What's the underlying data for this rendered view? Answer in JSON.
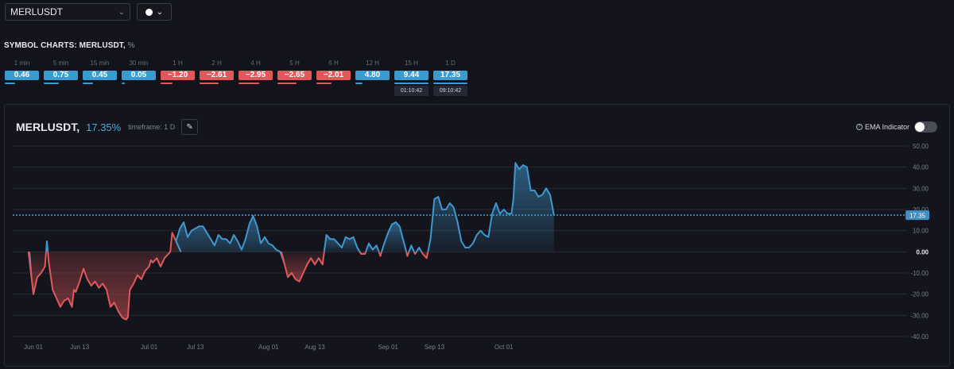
{
  "top": {
    "symbol": "MERLUSDT",
    "symbol_chevron": "chevron-down-icon",
    "color_chevron": "chevron-down-icon",
    "color_value": "#ffffff"
  },
  "section": {
    "title": "SYMBOL CHARTS: MERLUSDT,",
    "unit": "%"
  },
  "timeframes": [
    {
      "label": "1 min",
      "value": "0.46",
      "color": "#3a9bd1",
      "bar": 0.3
    },
    {
      "label": "5 min",
      "value": "0.75",
      "color": "#3a9bd1",
      "bar": 0.45
    },
    {
      "label": "15 min",
      "value": "0.45",
      "color": "#3a9bd1",
      "bar": 0.3
    },
    {
      "label": "30 min",
      "value": "0.05",
      "color": "#3a9bd1",
      "bar": 0.1
    },
    {
      "label": "1 H",
      "value": "−1.20",
      "color": "#e0585a",
      "bar": 0.35
    },
    {
      "label": "2 H",
      "value": "−2.61",
      "color": "#e0585a",
      "bar": 0.55
    },
    {
      "label": "4 H",
      "value": "−2.95",
      "color": "#e0585a",
      "bar": 0.6
    },
    {
      "label": "5 H",
      "value": "−2.65",
      "color": "#e0585a",
      "bar": 0.55
    },
    {
      "label": "6 H",
      "value": "−2.01",
      "color": "#e0585a",
      "bar": 0.45
    },
    {
      "label": "12 H",
      "value": "4.80",
      "color": "#3a9bd1",
      "bar": 0.2
    },
    {
      "label": "15 H",
      "value": "9.44",
      "color": "#3a9bd1",
      "bar": 1.0,
      "timer": "01:10:42"
    },
    {
      "label": "1 D",
      "value": "17.35",
      "color": "#3a9bd1",
      "bar": 1.0,
      "timer": "09:10:42"
    }
  ],
  "chart_header": {
    "symbol": "MERLUSDT,",
    "change": "17.35%",
    "timeframe": "timeframe: 1 D",
    "tool_icon": "pen-icon",
    "ema_label": "EMA Indicator",
    "ema_icon": "info-icon",
    "ema_enabled": false
  },
  "colors": {
    "positive": "#3f97cf",
    "negative": "#e0585a",
    "current_line": "#3f97cf",
    "badge_bg": "#3f8fc4"
  },
  "chart_data": {
    "type": "area",
    "title": "MERLUSDT, 17.35%",
    "xlabel": "",
    "ylabel": "",
    "ylim": [
      -40,
      50
    ],
    "y_ticks": [
      "50.00",
      "40.00",
      "30.00",
      "20.00",
      "10.00",
      "0.00",
      "-10.00",
      "-20.00",
      "-30.00",
      "-40.00"
    ],
    "x_ticks": [
      {
        "day": 0,
        "label": "Jun 01"
      },
      {
        "day": 12,
        "label": "Jun 13"
      },
      {
        "day": 30,
        "label": "Jul 01"
      },
      {
        "day": 42,
        "label": "Jul 13"
      },
      {
        "day": 61,
        "label": "Aug 01"
      },
      {
        "day": 73,
        "label": "Aug 13"
      },
      {
        "day": 92,
        "label": "Sep 01"
      },
      {
        "day": 104,
        "label": "Sep 13"
      },
      {
        "day": 122,
        "label": "Oct 01"
      }
    ],
    "current_value": 17.35,
    "current_label": "17.35",
    "grid": true,
    "series": [
      {
        "values": [
          [
            -1,
            0
          ],
          [
            -0.5,
            -12
          ],
          [
            0,
            -20
          ],
          [
            1,
            -12
          ],
          [
            2,
            -10
          ],
          [
            3,
            -7
          ],
          [
            3.5,
            5
          ],
          [
            4,
            -5
          ],
          [
            5,
            -18
          ],
          [
            6,
            -22
          ],
          [
            7,
            -26
          ],
          [
            8,
            -23
          ],
          [
            9,
            -22
          ],
          [
            10,
            -26
          ],
          [
            10.5,
            -18
          ],
          [
            11,
            -19
          ],
          [
            12,
            -14
          ],
          [
            13,
            -8
          ],
          [
            14,
            -13
          ],
          [
            15,
            -16
          ],
          [
            16,
            -14
          ],
          [
            17,
            -17
          ],
          [
            18,
            -15
          ],
          [
            19,
            -18
          ],
          [
            20,
            -26
          ],
          [
            21,
            -24
          ],
          [
            22,
            -28
          ],
          [
            23,
            -31
          ],
          [
            24,
            -32
          ],
          [
            24.5,
            -31
          ],
          [
            25,
            -18
          ],
          [
            26,
            -15
          ],
          [
            27,
            -11
          ],
          [
            28,
            -13
          ],
          [
            29,
            -9
          ],
          [
            30,
            -7
          ],
          [
            30.5,
            -4
          ],
          [
            31,
            -5
          ],
          [
            32,
            -3
          ],
          [
            33,
            -7
          ],
          [
            34,
            -3
          ],
          [
            35,
            -1
          ],
          [
            35.5,
            0
          ],
          [
            36,
            9
          ],
          [
            37,
            5
          ],
          [
            38,
            11
          ],
          [
            39,
            14
          ],
          [
            40,
            7
          ],
          [
            41,
            10
          ],
          [
            42,
            11
          ],
          [
            43,
            12
          ],
          [
            44,
            12
          ],
          [
            45,
            9
          ],
          [
            46,
            6
          ],
          [
            47,
            3
          ],
          [
            48,
            8
          ],
          [
            49,
            6
          ],
          [
            50,
            6
          ],
          [
            51,
            4
          ],
          [
            52,
            8
          ],
          [
            53,
            5
          ],
          [
            54,
            1
          ],
          [
            55,
            6
          ],
          [
            56,
            13
          ],
          [
            57,
            17
          ],
          [
            58,
            12
          ],
          [
            59,
            4
          ],
          [
            60,
            7
          ],
          [
            61,
            4
          ],
          [
            62,
            3
          ],
          [
            63,
            1
          ],
          [
            64,
            0
          ],
          [
            65,
            -5
          ],
          [
            66,
            -12
          ],
          [
            67,
            -10
          ],
          [
            68,
            -13
          ],
          [
            69,
            -14
          ],
          [
            70,
            -10
          ],
          [
            71,
            -6
          ],
          [
            72,
            -3
          ],
          [
            73,
            -6
          ],
          [
            74,
            -3
          ],
          [
            75,
            -6
          ],
          [
            76,
            8
          ],
          [
            77,
            6
          ],
          [
            78,
            6
          ],
          [
            79,
            4
          ],
          [
            80,
            2
          ],
          [
            81,
            7
          ],
          [
            82,
            6
          ],
          [
            83,
            7
          ],
          [
            84,
            2
          ],
          [
            85,
            -1
          ],
          [
            86,
            -1
          ],
          [
            87,
            4
          ],
          [
            88,
            1
          ],
          [
            89,
            3
          ],
          [
            90,
            -2
          ],
          [
            91,
            4
          ],
          [
            92,
            9
          ],
          [
            93,
            13
          ],
          [
            94,
            14
          ],
          [
            95,
            12
          ],
          [
            96,
            5
          ],
          [
            97,
            -2
          ],
          [
            98,
            3
          ],
          [
            99,
            -1
          ],
          [
            100,
            2
          ],
          [
            101,
            -1
          ],
          [
            102,
            -3
          ],
          [
            103,
            6
          ],
          [
            104,
            25
          ],
          [
            105,
            26
          ],
          [
            106,
            20
          ],
          [
            107,
            20
          ],
          [
            108,
            23
          ],
          [
            109,
            21
          ],
          [
            110,
            14
          ],
          [
            111,
            5
          ],
          [
            112,
            2
          ],
          [
            113,
            2
          ],
          [
            114,
            4
          ],
          [
            115,
            8
          ],
          [
            116,
            10
          ],
          [
            117,
            8
          ],
          [
            118,
            7
          ],
          [
            119,
            18
          ],
          [
            120,
            23
          ],
          [
            121,
            18
          ],
          [
            122,
            20
          ],
          [
            123,
            18
          ],
          [
            124,
            18
          ],
          [
            124.5,
            25
          ],
          [
            125,
            42
          ],
          [
            126,
            39
          ],
          [
            127,
            41
          ],
          [
            128,
            40
          ],
          [
            129,
            29
          ],
          [
            130,
            29
          ],
          [
            131,
            26
          ],
          [
            132,
            27
          ],
          [
            133,
            30
          ],
          [
            134,
            27
          ],
          [
            135,
            17.35
          ]
        ]
      }
    ]
  }
}
